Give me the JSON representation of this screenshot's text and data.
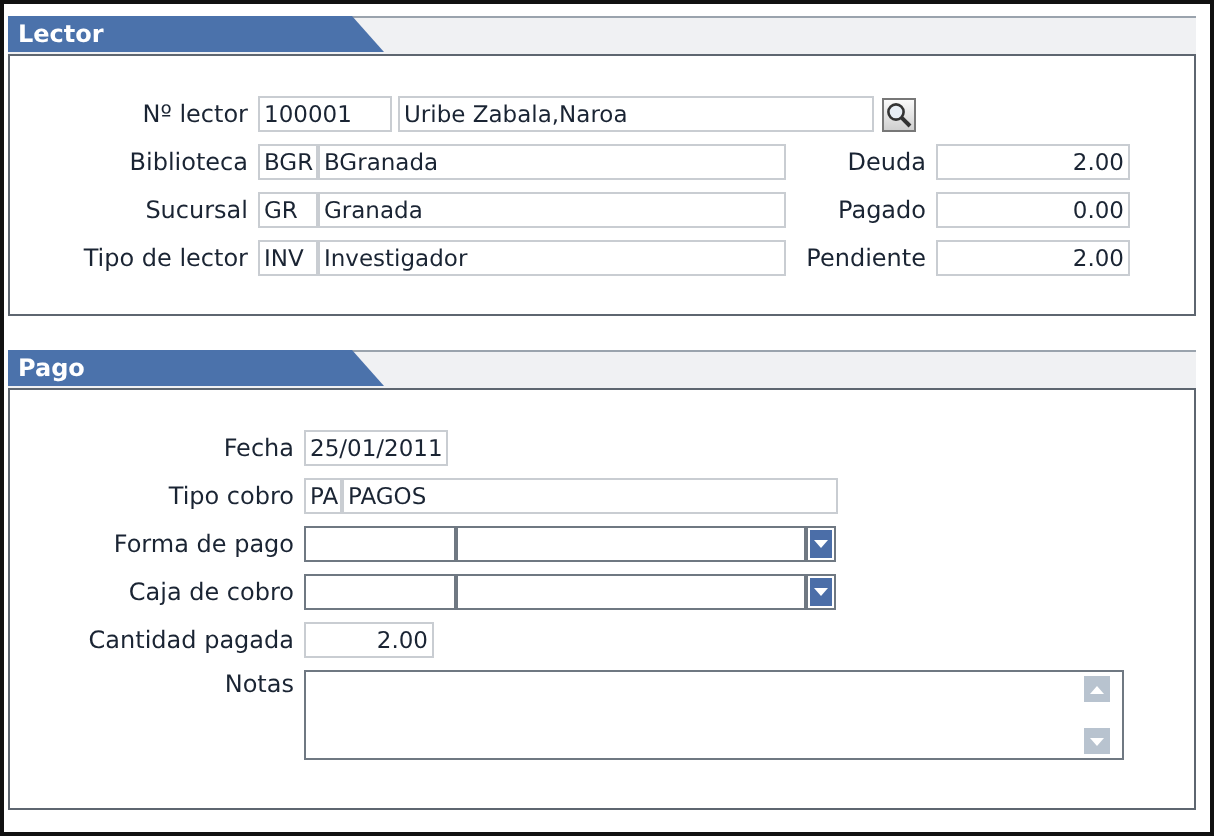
{
  "lector": {
    "title": "Lector",
    "reader": {
      "label": "Nº lector",
      "code": "100001",
      "name": "Uribe Zabala,Naroa"
    },
    "rows": [
      {
        "label": "Biblioteca",
        "code": "BGR",
        "name": "BGranada",
        "amount_label": "Deuda",
        "amount": "2.00"
      },
      {
        "label": "Sucursal",
        "code": "GR",
        "name": "Granada",
        "amount_label": "Pagado",
        "amount": "0.00"
      },
      {
        "label": "Tipo de lector",
        "code": "INV",
        "name": "Investigador",
        "amount_label": "Pendiente",
        "amount": "2.00"
      }
    ]
  },
  "pago": {
    "title": "Pago",
    "fields": [
      {
        "kind": "date",
        "label": "Fecha",
        "value": "25/01/2011"
      },
      {
        "kind": "coded",
        "label": "Tipo cobro",
        "code": "PA",
        "name": "PAGOS"
      },
      {
        "kind": "select",
        "label": "Forma de pago"
      },
      {
        "kind": "select",
        "label": "Caja de cobro"
      },
      {
        "kind": "amount",
        "label": "Cantidad pagada",
        "value": "2.00"
      },
      {
        "kind": "notes",
        "label": "Notas"
      }
    ]
  }
}
